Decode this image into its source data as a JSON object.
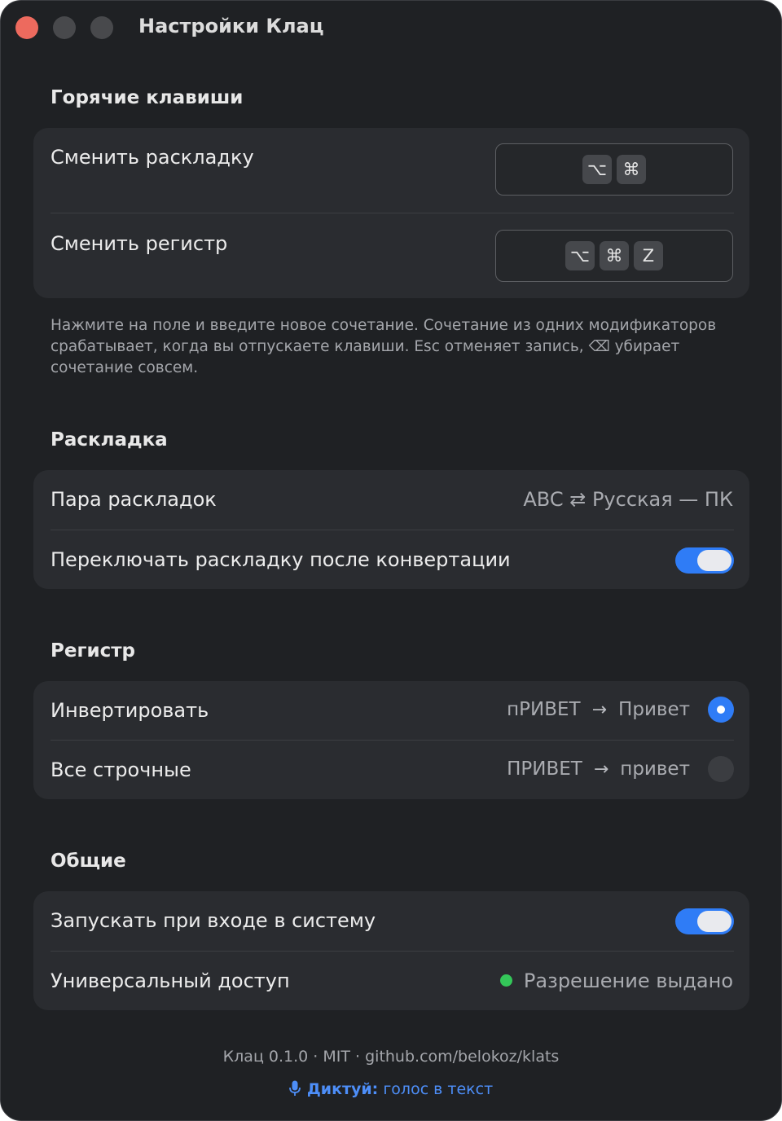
{
  "window": {
    "title": "Настройки Клац"
  },
  "sections": {
    "hotkeys": {
      "title": "Горячие клавиши",
      "rows": [
        {
          "label": "Сменить раскладку",
          "keys": [
            "⌥",
            "⌘"
          ]
        },
        {
          "label": "Сменить регистр",
          "keys": [
            "⌥",
            "⌘",
            "Z"
          ]
        }
      ],
      "hint": "Нажмите на поле и введите новое сочетание. Сочетание из одних модификаторов срабатывает, когда вы отпускаете клавиши. Esc отменяет запись, ⌫ убирает сочетание совсем."
    },
    "layout": {
      "title": "Раскладка",
      "pair_label": "Пара раскладок",
      "pair_value": "ABC ⇄ Русская — ПК",
      "switch_label": "Переключать раскладку после конвертации",
      "switch_on": true
    },
    "case": {
      "title": "Регистр",
      "options": [
        {
          "label": "Инвертировать",
          "from": "пРИВЕТ",
          "to": "Привет",
          "selected": true
        },
        {
          "label": "Все строчные",
          "from": "ПРИВЕТ",
          "to": "привет",
          "selected": false
        }
      ],
      "arrow": "→"
    },
    "general": {
      "title": "Общие",
      "launch_label": "Запускать при входе в систему",
      "launch_on": true,
      "access_label": "Универсальный доступ",
      "access_status": "Разрешение выдано",
      "access_status_color": "#34c759"
    }
  },
  "footer": {
    "info": "Клац 0.1.0 · MIT · github.com/belokoz/klats",
    "promo_bold": "Диктуй:",
    "promo_rest": " голос в текст",
    "promo_icon": "microphone-icon"
  },
  "colors": {
    "accent": "#2f7cf6",
    "close": "#ed6a5e",
    "background": "#1f2124",
    "card": "#2a2c30"
  }
}
